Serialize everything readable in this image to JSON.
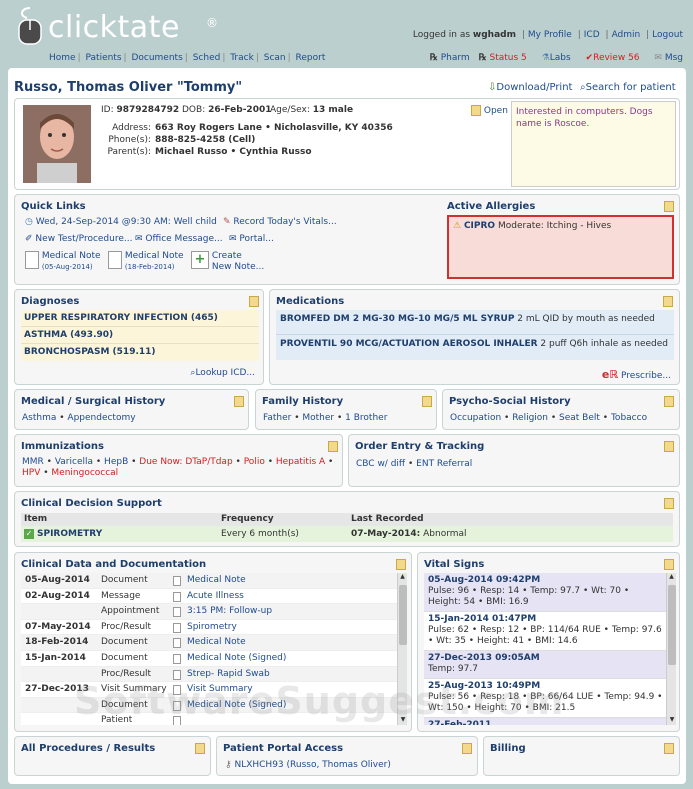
{
  "app": {
    "logo": "clicktate",
    "reg": "®"
  },
  "toplinks": {
    "logged_prefix": "Logged in as",
    "user": "wghadm",
    "profile": "My Profile",
    "icd": "ICD",
    "admin": "Admin",
    "logout": "Logout"
  },
  "nav": [
    "Home",
    "Patients",
    "Documents",
    "Sched",
    "Track",
    "Scan",
    "Report"
  ],
  "rightnav": {
    "pharm": "Pharm",
    "status": "Status 5",
    "labs": "Labs",
    "review": "Review 56",
    "msg": "Msg"
  },
  "patient": {
    "name": "Russo, Thomas Oliver \"Tommy\"",
    "download": "Download/Print",
    "search": "Search for patient",
    "id_label": "ID:",
    "id": "9879284792",
    "dob_label": "DOB:",
    "dob": "26-Feb-2001",
    "agesex_label": "Age/Sex:",
    "agesex": "13 male",
    "address_label": "Address:",
    "address": "663 Roy Rogers Lane • Nicholasville, KY 40356",
    "phone_label": "Phone(s):",
    "phone": "888-825-4258 (Cell)",
    "parents_label": "Parent(s):",
    "parents": "Michael Russo • Cynthia Russo",
    "open": "Open",
    "note": "Interested in computers. Dogs name is Roscoe."
  },
  "quicklinks": {
    "title": "Quick Links",
    "appt": "Wed, 24-Sep-2014 @9:30 AM: Well child",
    "vitals": "Record Today's Vitals...",
    "newtest": "New Test/Procedure...",
    "office": "Office Message...",
    "portal": "Portal...",
    "note1": "Medical Note",
    "note1_date": "(05-Aug-2014)",
    "note2": "Medical Note",
    "note2_date": "(18-Feb-2014)",
    "create1": "Create",
    "create2": "New Note..."
  },
  "allergies": {
    "title": "Active Allergies",
    "drug": "CIPRO",
    "detail": "Moderate: Itching - Hives"
  },
  "diagnoses": {
    "title": "Diagnoses",
    "items": [
      "UPPER RESPIRATORY INFECTION (465)",
      "ASTHMA (493.90)",
      "BRONCHOSPASM (519.11)"
    ],
    "lookup": "Lookup ICD..."
  },
  "medications": {
    "title": "Medications",
    "items": [
      {
        "name": "BROMFED DM 2 MG-30 MG-10 MG/5 ML SYRUP",
        "sig": "2 mL QID by mouth as needed"
      },
      {
        "name": "PROVENTIL 90 MCG/ACTUATION AEROSOL INHALER",
        "sig": "2 puff Q6h inhale as needed"
      }
    ],
    "prescribe": "Prescribe..."
  },
  "medhist": {
    "title": "Medical / Surgical History",
    "items": [
      "Asthma",
      "Appendectomy"
    ]
  },
  "famhist": {
    "title": "Family History",
    "items": [
      "Father",
      "Mother",
      "1 Brother"
    ]
  },
  "psych": {
    "title": "Psycho-Social History",
    "items": [
      "Occupation",
      "Religion",
      "Seat Belt",
      "Tobacco"
    ]
  },
  "immun": {
    "title": "Immunizations",
    "done": [
      "MMR",
      "Varicella",
      "HepB"
    ],
    "due_label": "Due Now: DTaP/Tdap",
    "due": [
      "Polio",
      "Hepatitis A",
      "HPV",
      "Meningococcal"
    ]
  },
  "orders": {
    "title": "Order Entry & Tracking",
    "items": [
      "CBC w/ diff",
      "ENT Referral"
    ]
  },
  "cds": {
    "title": "Clinical Decision Support",
    "col_item": "Item",
    "col_freq": "Frequency",
    "col_last": "Last Recorded",
    "item": "SPIROMETRY",
    "freq": "Every 6 month(s)",
    "last_date": "07-May-2014:",
    "last_result": "Abnormal"
  },
  "clinical": {
    "title": "Clinical Data and Documentation",
    "rows": [
      {
        "date": "05-Aug-2014",
        "type": "Document",
        "desc": "Medical Note"
      },
      {
        "date": "02-Aug-2014",
        "type": "Message",
        "desc": "Acute Illness"
      },
      {
        "date": "",
        "type": "Appointment",
        "desc": "3:15 PM: Follow-up"
      },
      {
        "date": "07-May-2014",
        "type": "Proc/Result",
        "desc": "Spirometry"
      },
      {
        "date": "18-Feb-2014",
        "type": "Document",
        "desc": "Medical Note"
      },
      {
        "date": "15-Jan-2014",
        "type": "Document",
        "desc": "Medical Note (Signed)"
      },
      {
        "date": "",
        "type": "Proc/Result",
        "desc": "Strep- Rapid Swab"
      },
      {
        "date": "27-Dec-2013",
        "type": "Visit Summary",
        "desc": "Visit Summary"
      },
      {
        "date": "",
        "type": "Document",
        "desc": "Medical Note (Signed)"
      },
      {
        "date": "",
        "type": "Patient",
        "desc": ""
      }
    ]
  },
  "vitals": {
    "title": "Vital Signs",
    "entries": [
      {
        "date": "05-Aug-2014 09:42PM",
        "text": "Pulse: 96 • Resp: 14 • Temp: 97.7 • Wt: 70 • Height: 54 • BMI: 16.9"
      },
      {
        "date": "15-Jan-2014 01:47PM",
        "text": "Pulse: 62 • Resp: 12 • BP: 114/64 RUE • Temp: 97.6 • Wt: 35 • Height: 41 • BMI: 14.6"
      },
      {
        "date": "27-Dec-2013 09:05AM",
        "text": "Temp: 97.7"
      },
      {
        "date": "25-Aug-2013 10:49PM",
        "text": "Pulse: 56 • Resp: 18 • BP: 66/64 LUE • Temp: 94.9 • Wt: 150 • Height: 70 • BMI: 21.5"
      },
      {
        "date": "27-Feb-2011",
        "text": ""
      }
    ]
  },
  "procedures": {
    "title": "All Procedures / Results"
  },
  "portal": {
    "title": "Patient Portal Access",
    "item": "NLXHCH93 (Russo, Thomas Oliver)"
  },
  "billing": {
    "title": "Billing"
  },
  "watermark": "SoftwareSuggest.com",
  "colors": {
    "bg": "#bccfcf",
    "title": "#1e3e6b",
    "link": "#1f4b8e",
    "red": "#d42020",
    "allergy_bg": "#f7dcd7",
    "cds_bg": "#e5f3dc",
    "diag_bg": "#fdf5d9",
    "med_bg": "#e1ecf7"
  }
}
